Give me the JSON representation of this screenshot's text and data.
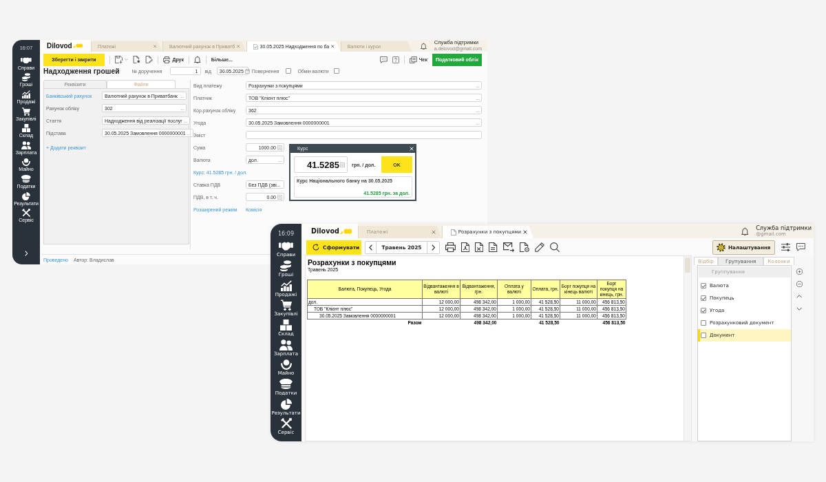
{
  "payment_window": {
    "sidebar": {
      "time": "16:07",
      "items": [
        {
          "label": "Справи"
        },
        {
          "label": "Гроші"
        },
        {
          "label": "Продажі"
        },
        {
          "label": "Закупівлі"
        },
        {
          "label": "Склад"
        },
        {
          "label": "Зарплата"
        },
        {
          "label": "Майно"
        },
        {
          "label": "Податки"
        },
        {
          "label": "Результати"
        },
        {
          "label": "Сервіс"
        }
      ],
      "collapse_toggle": true
    },
    "topbar": {
      "logo": "Dilovod",
      "tabs": [
        {
          "label": "Платежі",
          "selected": false,
          "closable": true
        },
        {
          "label": "Валютний рахунок в Приватб",
          "selected": false,
          "closable": true
        },
        {
          "label": "30.05.2025 Надходження по ба",
          "selected": true,
          "closable": true
        },
        {
          "label": "Валюти і курси",
          "selected": false,
          "closable": false
        }
      ],
      "support": {
        "title": "Служба підтримки",
        "email": "a.delovod@gmail.com"
      }
    },
    "toolbar": {
      "save_button": "Зберегти і закрити",
      "print_button": "Друк",
      "more_button": "Більше...",
      "receipt_button": "Чек",
      "tax_button": "Податковий облік"
    },
    "header": {
      "title": "Надходження грошей",
      "number_label": "№ доручення",
      "number": "1",
      "date_label": "від",
      "date": "30.05.2025",
      "checks": [
        {
          "label": "Повернення",
          "checked": false
        },
        {
          "label": "Обмін валюти",
          "checked": false
        }
      ]
    },
    "details_panel": {
      "tabs": [
        {
          "label": "Реквізити",
          "selected": true
        },
        {
          "label": "Файли",
          "selected": false
        }
      ],
      "rows": [
        {
          "label": "Банківський рахунок",
          "link": true,
          "value": "Валютний рахунок в Приватбанк",
          "button": "..."
        },
        {
          "label": "Рахунок обліку",
          "link": false,
          "value": "302",
          "button": "..."
        },
        {
          "label": "Стаття",
          "link": false,
          "value": "Надходження від реалізації послуг",
          "button": "..."
        },
        {
          "label": "Підстава",
          "link": false,
          "value": "30.05.2025 Замовлення 0000000001",
          "button": "..."
        }
      ],
      "add_link": "+ Додати реквізит"
    },
    "payment_form": {
      "fields": [
        {
          "kind": "select",
          "label": "Вид платежу",
          "value": "Розрахунки з покупцями",
          "button": "..."
        },
        {
          "kind": "select",
          "label": "Платник",
          "value": "ТОВ \"Клієнт плюс\"",
          "button": "..."
        },
        {
          "kind": "select",
          "label": "Кор.рахунок обліку",
          "value": "362",
          "button": "..."
        },
        {
          "kind": "select",
          "label": "Угода",
          "value": "30.05.2025 Замовлення 0000000001",
          "button": "..."
        },
        {
          "kind": "text",
          "label": "Зміст"
        },
        {
          "kind": "amount",
          "label": "Сума",
          "value": "1000.00"
        },
        {
          "kind": "short_select",
          "label": "Валюта",
          "value": "дол.",
          "button": "..."
        },
        {
          "kind": "link",
          "label": "Курс: 41.5285 грн. / дол."
        },
        {
          "kind": "short",
          "label": "Ставка ПДВ",
          "value": "Без ПДВ (зві..."
        },
        {
          "kind": "amount",
          "label": "ПДВ, в т. ч.",
          "value": "0.00"
        }
      ],
      "links": [
        "Розширений режим",
        "Комісія"
      ]
    },
    "rate_dialog": {
      "title": "Курс",
      "rate": "41.5285",
      "unit": "грн. / дол.",
      "ok_button": "OK",
      "nbu_title": "Курс Національного банку на 30.05.2025",
      "nbu_rate": "41.5285 грн. за дол."
    },
    "footer": {
      "status": "Проведено",
      "author": "Автор: Владислав"
    }
  },
  "report_window": {
    "sidebar": {
      "time": "16:09",
      "items": [
        {
          "label": "Справи"
        },
        {
          "label": "Гроші"
        },
        {
          "label": "Продажі"
        },
        {
          "label": "Закупівлі"
        },
        {
          "label": "Склад"
        },
        {
          "label": "Зарплата"
        },
        {
          "label": "Майно"
        },
        {
          "label": "Податки"
        },
        {
          "label": "Результати"
        },
        {
          "label": "Сервіс"
        }
      ]
    },
    "topbar": {
      "logo": "Dilovod",
      "tabs": [
        {
          "label": "Платежі",
          "selected": false,
          "closable": true
        },
        {
          "label": "Розрахунки з покупцями",
          "selected": true,
          "closable": true
        }
      ],
      "support": {
        "title": "Служба підтримки",
        "email": "@gmail.com"
      }
    },
    "toolbar": {
      "generate_button": "Сформувати",
      "period": "Травень 2025",
      "settings_button": {
        "label": "Налаштування",
        "active": true
      }
    },
    "report": {
      "title": "Розрахунки з покупцями",
      "subtitle": "Травень 2025",
      "table": {
        "columns": [
          "Валюта, Покупець, Угода",
          "Відвантаження в валюті",
          "Відвантаження, грн.",
          "Оплата у валюті",
          "Оплата, грн.",
          "Борг покупця на кінець валюті",
          "Борг покупця на кінець, грн."
        ],
        "rows": [
          {
            "label": "дол.",
            "values": [
              "12 000,00",
              "498 342,00",
              "1 000,00",
              "41 528,50",
              "11 000,00",
              "456 813,50"
            ],
            "children": [
              {
                "label": "ТОВ \"Клієнт плюс\"",
                "values": [
                  "12 000,00",
                  "498 342,00",
                  "1 000,00",
                  "41 528,50",
                  "11 000,00",
                  "456 813,50"
                ],
                "children": [
                  {
                    "label": "30.05.2025 Замовлення 0000000001",
                    "values": [
                      "12 000,00",
                      "498 342,00",
                      "1 000,00",
                      "41 528,50",
                      "11 000,00",
                      "456 813,50"
                    ]
                  }
                ]
              }
            ]
          }
        ],
        "total": {
          "label": "Разом",
          "shipment_uah": "498 342,00",
          "payment_uah": "41 528,50",
          "debt_uah": "456 813,50"
        }
      }
    },
    "settings_panel": {
      "tabs": [
        {
          "label": "Відбір",
          "selected": false
        },
        {
          "label": "Групування",
          "selected": true
        },
        {
          "label": "Колонки",
          "selected": false
        }
      ],
      "list_header": "Группування",
      "items": [
        {
          "label": "Валюта",
          "checked": true,
          "selected": false
        },
        {
          "label": "Покупець",
          "checked": true,
          "selected": false
        },
        {
          "label": "Угода",
          "checked": true,
          "selected": false
        },
        {
          "label": "Розрахунковий документ",
          "checked": false,
          "selected": false
        },
        {
          "label": "Документ",
          "checked": false,
          "selected": true
        }
      ]
    }
  }
}
